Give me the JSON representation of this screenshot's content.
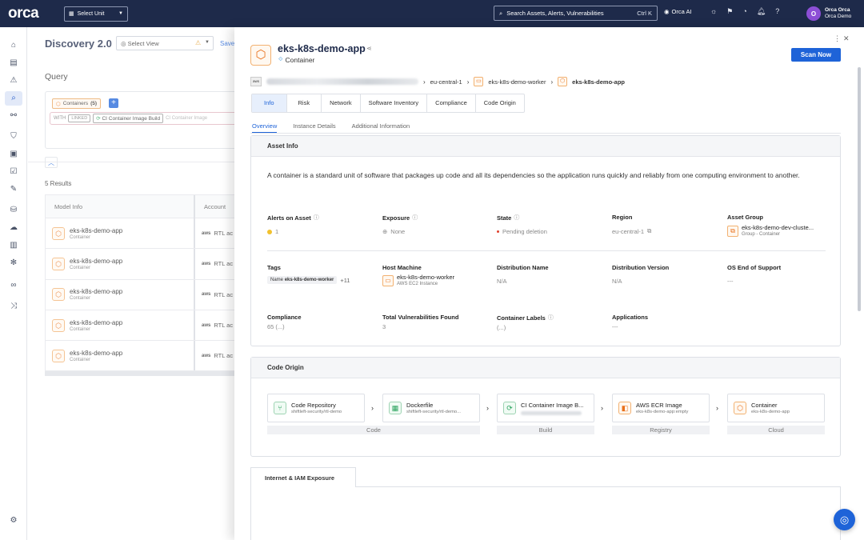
{
  "topbar": {
    "logo": "orca",
    "unit_select": "Select Unit",
    "search_placeholder": "Search Assets, Alerts, Vulnerabilities",
    "search_shortcut": "Ctrl K",
    "orca_ai": "Orca AI",
    "avatar_initial": "O",
    "user_name": "Orca Orca",
    "org_name": "Orca Demo"
  },
  "page": {
    "title": "Discovery 2.0",
    "select_view": "Select View",
    "save": "Save",
    "query_label": "Query",
    "chip_containers": "Containers",
    "chip_count": "(5)",
    "with_label": "WITH",
    "linked_label": "LINKED",
    "ci_chip": "CI Container Image Build",
    "ci_chip_faded": "CI Container Image",
    "results": "5 Results",
    "col_model": "Model Info",
    "col_account": "Account",
    "rows": [
      {
        "name": "eks-k8s-demo-app",
        "type": "Container",
        "account": "RTL ac"
      },
      {
        "name": "eks-k8s-demo-app",
        "type": "Container",
        "account": "RTL ac"
      },
      {
        "name": "eks-k8s-demo-app",
        "type": "Container",
        "account": "RTL ac"
      },
      {
        "name": "eks-k8s-demo-app",
        "type": "Container",
        "account": "RTL ac"
      },
      {
        "name": "eks-k8s-demo-app",
        "type": "Container",
        "account": "RTL ac"
      }
    ]
  },
  "drawer": {
    "title": "eks-k8s-demo-app",
    "subtitle": "Container",
    "scan_button": "Scan Now",
    "breadcrumb": {
      "region": "eu-central-1",
      "worker": "eks-k8s-demo-worker",
      "app": "eks-k8s-demo-app"
    },
    "tabs": [
      "Info",
      "Risk",
      "Network",
      "Software Inventory",
      "Compliance",
      "Code Origin"
    ],
    "subtabs": [
      "Overview",
      "Instance Details",
      "Additional Information"
    ],
    "asset_info": {
      "heading": "Asset Info",
      "description": "A container is a standard unit of software that packages up code and all its dependencies so the application runs quickly and reliably from one computing environment to another.",
      "alerts_label": "Alerts on Asset",
      "alerts_value": "1",
      "exposure_label": "Exposure",
      "exposure_value": "None",
      "state_label": "State",
      "state_value": "Pending deletion",
      "region_label": "Region",
      "region_value": "eu-central-1",
      "group_label": "Asset Group",
      "group_value": "eks-k8s-demo-dev-cluste...",
      "group_sub": "Group - Container",
      "tags_label": "Tags",
      "tag_key": "Name",
      "tag_value": "eks-k8s-demo-worker",
      "tag_more": "+11",
      "host_label": "Host Machine",
      "host_value": "eks-k8s-demo-worker",
      "host_sub": "AWS EC2 Instance",
      "dist_name_label": "Distribution Name",
      "dist_name_value": "N/A",
      "dist_ver_label": "Distribution Version",
      "dist_ver_value": "N/A",
      "os_label": "OS End of Support",
      "os_value": "---",
      "compliance_label": "Compliance",
      "compliance_value": "65 (...)",
      "vulns_label": "Total Vulnerabilities Found",
      "vulns_value": "3",
      "labels_label": "Container Labels",
      "labels_value": "(...)",
      "apps_label": "Applications",
      "apps_value": "---"
    },
    "code_origin": {
      "heading": "Code Origin",
      "items": [
        {
          "name": "Code Repository",
          "sub": "shiftleft-security/rtl-demo"
        },
        {
          "name": "Dockerfile",
          "sub": "shiftleft-security/rtl-demo..."
        },
        {
          "name": "CI Container Image B...",
          "sub": ""
        },
        {
          "name": "AWS ECR Image",
          "sub": "eks-k8s-demo-app:empty"
        },
        {
          "name": "Container",
          "sub": "eks-k8s-demo-app"
        }
      ],
      "stages": [
        "Code",
        "Build",
        "Registry",
        "Cloud"
      ]
    },
    "exposure_tab": "Internet & IAM Exposure"
  },
  "icons": {
    "container": "container-hex-icon",
    "search": "search-icon",
    "gear": "gear-icon"
  },
  "colors": {
    "topbar": "#1e2a4a",
    "accent": "#1e63d8",
    "container_orange": "#e9711c"
  }
}
